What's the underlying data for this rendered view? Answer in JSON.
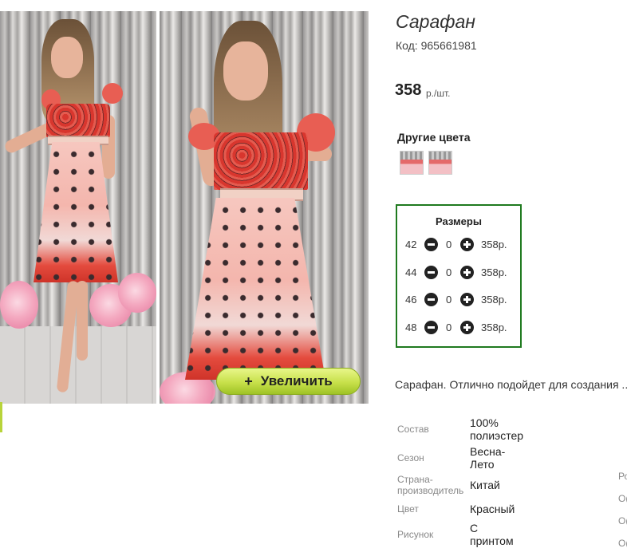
{
  "product": {
    "title": "Сарафан",
    "code": "Код: 965661981",
    "price": "358",
    "price_unit": "р./шт."
  },
  "zoom": {
    "label": "Увеличить",
    "plus": "+"
  },
  "other_colors": {
    "title": "Другие цвета",
    "thumbnails": [
      "color-variant-1",
      "color-variant-2"
    ]
  },
  "sizes": {
    "title": "Размеры",
    "rows": [
      {
        "size": "42",
        "qty": "0",
        "price": "358р."
      },
      {
        "size": "44",
        "qty": "0",
        "price": "358р."
      },
      {
        "size": "46",
        "qty": "0",
        "price": "358р."
      },
      {
        "size": "48",
        "qty": "0",
        "price": "358р."
      }
    ]
  },
  "description": "Сарафан. Отлично подойдет для создания ...",
  "specs": [
    {
      "label": "Состав",
      "value": "100% полиэстер"
    },
    {
      "label": "Сезон",
      "value": "Весна-Лето"
    },
    {
      "label": "Страна-производитель",
      "value": "Китай"
    },
    {
      "label": "Цвет",
      "value": "Красный"
    },
    {
      "label": "Рисунок",
      "value": "С принтом"
    }
  ],
  "right_edge_chars": [
    "Ро",
    "О(",
    "О(",
    "О("
  ]
}
